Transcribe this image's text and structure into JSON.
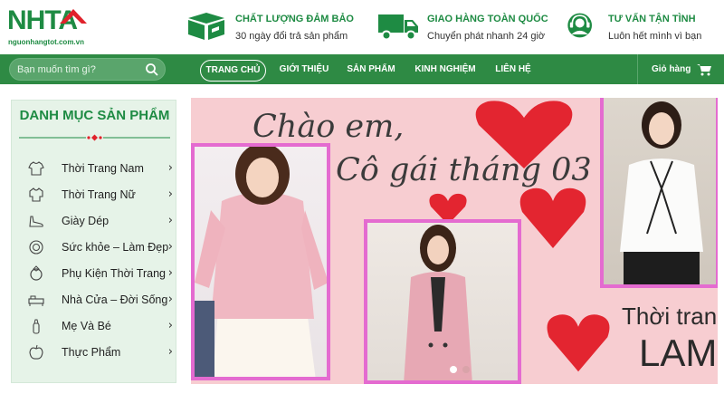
{
  "logo": {
    "text": "NHTA",
    "subtext": "nguonhangtot.com.vn"
  },
  "features": [
    {
      "title": "Chất lượng đảm bảo",
      "subtitle": "30 ngày đổi trả sản phẩm",
      "icon": "box-icon"
    },
    {
      "title": "Giao hàng toàn quốc",
      "subtitle": "Chuyển phát nhanh 24 giờ",
      "icon": "truck-icon"
    },
    {
      "title": "Tư vấn tận tình",
      "subtitle": "Luôn hết mình vì bạn",
      "icon": "support-headset-icon"
    }
  ],
  "search": {
    "placeholder": "Bạn muốn tìm gì?"
  },
  "menu": {
    "items": [
      "Trang chủ",
      "Giới thiệu",
      "Sản phẩm",
      "Kinh nghiệm",
      "Liên hệ"
    ],
    "active_index": 0,
    "cart_label": "Giỏ hàng"
  },
  "catalog": {
    "title": "Danh mục sản phẩm",
    "items": [
      {
        "label": "Thời Trang Nam",
        "icon": "shirt-icon"
      },
      {
        "label": "Thời Trang Nữ",
        "icon": "blouse-icon"
      },
      {
        "label": "Giày Dép",
        "icon": "shoe-icon"
      },
      {
        "label": "Sức khỏe – Làm Đẹp",
        "icon": "cosmetics-icon"
      },
      {
        "label": "Phụ Kiện Thời Trang",
        "icon": "ring-icon"
      },
      {
        "label": "Nhà Cửa – Đời Sống",
        "icon": "bed-icon"
      },
      {
        "label": "Mẹ Và Bé",
        "icon": "baby-bottle-icon"
      },
      {
        "label": "Thực Phẩm",
        "icon": "apple-icon"
      }
    ],
    "chevron": "›"
  },
  "banner": {
    "headline_1": "Chào em,",
    "headline_2": "Cô gái tháng 03",
    "tagline_1": "Thời trang",
    "tagline_2": "LAM",
    "slides": 2,
    "active_slide": 0
  },
  "colors": {
    "brand_green": "#2e8a44",
    "accent_red": "#e0222b",
    "banner_pink": "#f7cdd1"
  }
}
